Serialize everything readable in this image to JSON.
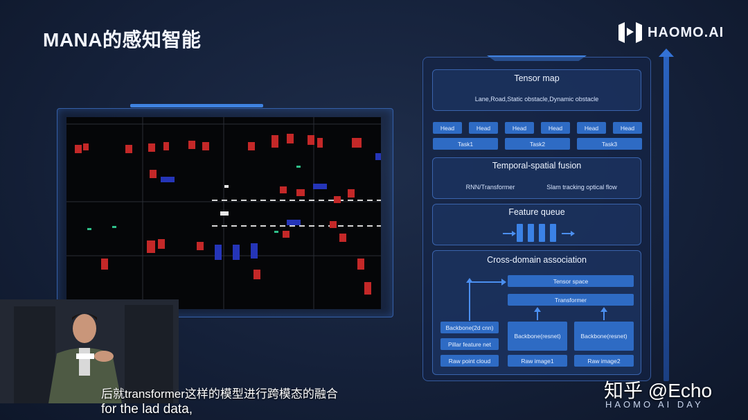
{
  "slide": {
    "title": "MANA的感知智能"
  },
  "logo": {
    "text": "HAOMO.AI"
  },
  "arch": {
    "tensor_map": {
      "title": "Tensor map",
      "subtitle": "Lane,Road,Static obstacle,Dynamic obstacle"
    },
    "heads": [
      "Head",
      "Head",
      "Head",
      "Head",
      "Head",
      "Head"
    ],
    "tasks": [
      "Task1",
      "Task2",
      "Task3"
    ],
    "fusion": {
      "title": "Temporal-spatial fusion",
      "items": [
        "RNN/Transformer",
        "Slam tracking optical flow"
      ]
    },
    "queue": {
      "title": "Feature queue"
    },
    "cross": {
      "title": "Cross-domain association",
      "tensor_space": "Tensor space",
      "transformer": "Transformer",
      "lidar": [
        "Backbone(2d cnn)",
        "Pillar feature net",
        "Raw point cloud"
      ],
      "cam1": {
        "backbone": "Backbone(resnet)",
        "input": "Raw image1"
      },
      "cam2": {
        "backbone": "Backbone(resnet)",
        "input": "Raw image2"
      }
    }
  },
  "subtitles": {
    "cn": "后就transformer这样的模型进行跨模态的融合",
    "en": "for the lad data,"
  },
  "watermark": "知乎 @Echo",
  "event": "HAOMO AI DAY",
  "colors": {
    "accent": "#3f82e0",
    "chip": "#2e6bc4",
    "obstacle": "#c42828",
    "vehicle": "#2535b8"
  }
}
